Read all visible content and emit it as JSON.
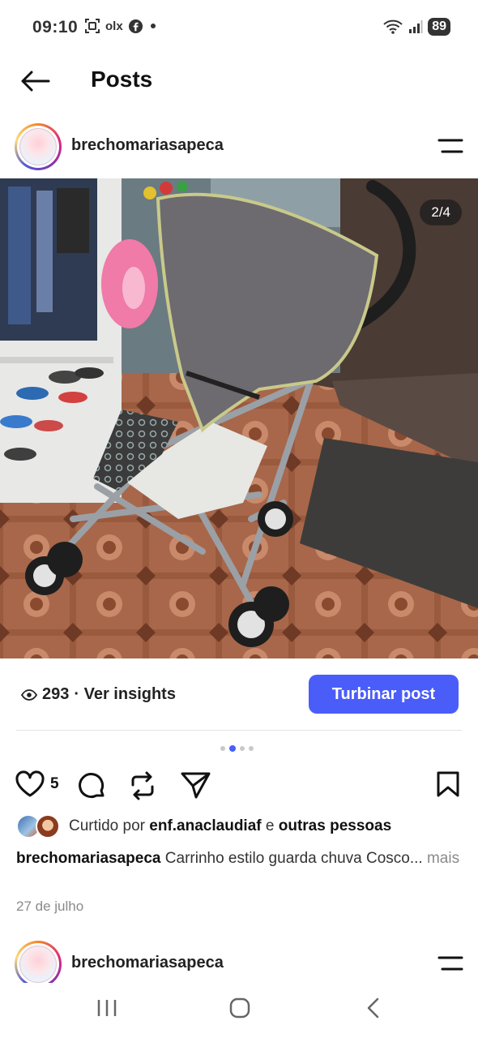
{
  "status_bar": {
    "time": "09:10",
    "left_icons": [
      "screenshot-icon",
      "olx-icon",
      "facebook-icon",
      "dot-icon"
    ],
    "olx_label": "olx",
    "battery": "89"
  },
  "header": {
    "title": "Posts"
  },
  "post": {
    "username": "brechomariasapeca",
    "photo_counter": "2/4",
    "views": "293",
    "insights_label": "· Ver insights",
    "boost_label": "Turbinar post",
    "carousel_total": 4,
    "carousel_active": 2,
    "like_count": "5",
    "liked_by_prefix": "Curtido por",
    "liked_by_user": "enf.anaclaudiaf",
    "liked_by_joiner": "e",
    "liked_by_others": "outras pessoas",
    "caption_user": "brechomariasapeca",
    "caption_text": "Carrinho estilo guarda chuva Cosco...",
    "caption_more": "mais",
    "date": "27 de julho"
  },
  "next_post": {
    "username": "brechomariasapeca"
  },
  "colors": {
    "accent": "#4a5df9",
    "muted": "#8a8a8a"
  }
}
